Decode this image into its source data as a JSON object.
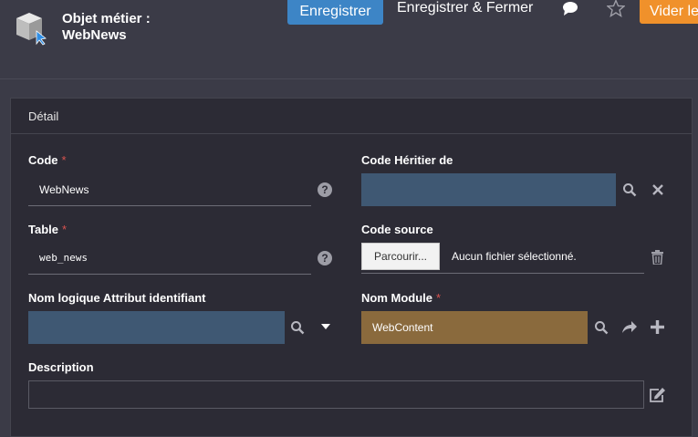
{
  "header": {
    "title_line1": "Objet métier :",
    "title_line2": "WebNews",
    "save_label": "Enregistrer",
    "save_close_label": "Enregistrer & Fermer",
    "clear_label": "Vider le"
  },
  "panel": {
    "title": "Détail"
  },
  "form": {
    "code": {
      "label": "Code",
      "required": "*",
      "value": "WebNews"
    },
    "code_heritier": {
      "label": "Code Héritier de"
    },
    "table": {
      "label": "Table",
      "required": "*",
      "value": "web_news"
    },
    "code_source": {
      "label": "Code source",
      "browse_label": "Parcourir...",
      "no_file_text": "Aucun fichier sélectionné."
    },
    "nom_logique": {
      "label": "Nom logique Attribut identifiant"
    },
    "nom_module": {
      "label": "Nom Module",
      "required": "*",
      "value": "WebContent"
    },
    "description": {
      "label": "Description"
    }
  },
  "colors": {
    "primary_button": "#3d85c6",
    "warning_button": "#f0912b",
    "lookup_field": "#3f5873",
    "module_field": "#8a6a3d",
    "required_marker": "#d9534f"
  },
  "icons": {
    "app": "business-object-cube-icon",
    "comment": "comment-icon",
    "favorite": "star-icon",
    "help": "question-circle-icon",
    "search": "search-icon",
    "clear": "close-icon",
    "dropdown": "caret-down-icon",
    "delete": "trash-icon",
    "navigate": "share-arrow-icon",
    "add": "plus-icon",
    "edit": "edit-icon"
  }
}
